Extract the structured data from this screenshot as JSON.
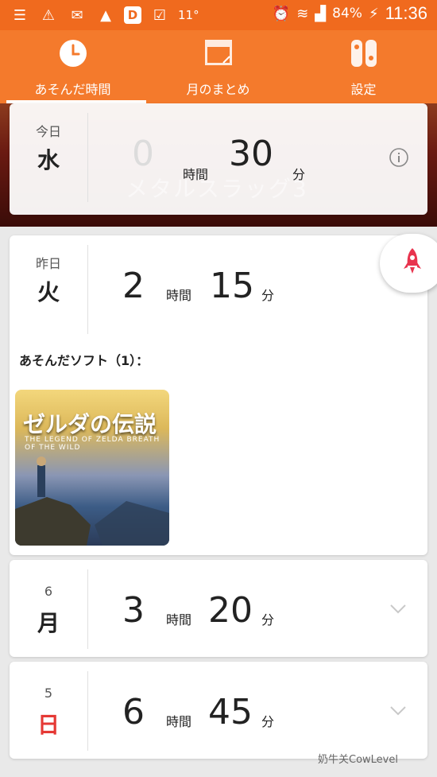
{
  "status_bar": {
    "temperature": "11°",
    "battery": "84%",
    "time": "11:36",
    "icons": [
      "menu-icon",
      "warning-icon",
      "mail-icon",
      "rocket-icon",
      "d-app-icon",
      "briefcase-icon",
      "alarm-icon",
      "wifi-icon",
      "signal-icon",
      "battery-charging-icon"
    ]
  },
  "tabs": [
    {
      "label": "あそんだ時間",
      "icon": "clock-icon",
      "active": true
    },
    {
      "label": "月のまとめ",
      "icon": "calendar-icon",
      "active": false
    },
    {
      "label": "設定",
      "icon": "switch-icon",
      "active": false
    }
  ],
  "banner": {
    "game_title": "メタルスラッグ3"
  },
  "days": [
    {
      "small": "今日",
      "big": "水",
      "hours_ghost": "0",
      "hours_label": "時間",
      "minutes": "30",
      "minutes_label": "分"
    },
    {
      "small": "昨日",
      "big": "火",
      "hours": "2",
      "hours_label": "時間",
      "minutes": "15",
      "minutes_label": "分"
    },
    {
      "small": "6",
      "big": "月",
      "hours": "3",
      "hours_label": "時間",
      "minutes": "20",
      "minutes_label": "分"
    },
    {
      "small": "5",
      "big": "日",
      "hours": "6",
      "hours_label": "時間",
      "minutes": "45",
      "minutes_label": "分"
    }
  ],
  "played_software_label": "あそんだソフト（1）：",
  "game": {
    "title": "ゼルダの伝説",
    "subtitle": "THE LEGEND OF ZELDA  BREATH OF THE WILD"
  },
  "watermark": "奶牛关CowLevel",
  "colors": {
    "brand": "#f47a2c",
    "status": "#f06a1e",
    "sunday": "#e53935"
  }
}
